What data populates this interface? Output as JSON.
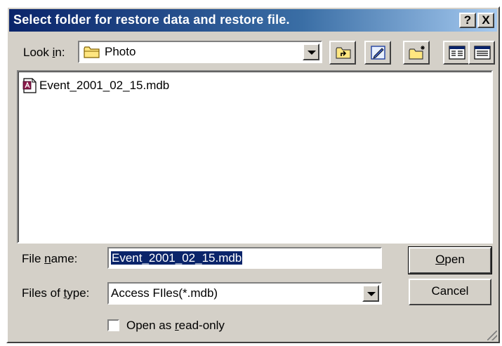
{
  "dialog": {
    "title": "Select folder for restore data and restore file.",
    "help_glyph": "?",
    "close_glyph": "X"
  },
  "look_in": {
    "label_pre": "Look ",
    "label_accel": "i",
    "label_post": "n:",
    "value": "Photo"
  },
  "files": [
    {
      "name": "Event_2001_02_15.mdb",
      "icon": "access-file-icon"
    }
  ],
  "file_name": {
    "label_pre": "File ",
    "label_accel": "n",
    "label_post": "ame:",
    "value": "Event_2001_02_15.mdb"
  },
  "file_type": {
    "label_pre": "Files of ",
    "label_accel": "t",
    "label_post": "ype:",
    "value": "Access FIles(*.mdb)"
  },
  "read_only": {
    "label_pre": "Open as ",
    "label_accel": "r",
    "label_post": "ead-only",
    "checked": false
  },
  "buttons": {
    "open_accel": "O",
    "open_rest": "pen",
    "cancel": "Cancel"
  },
  "colors": {
    "title_bar": "#0a246a",
    "dialog_face": "#d4d0c8",
    "selection": "#0a246a"
  }
}
